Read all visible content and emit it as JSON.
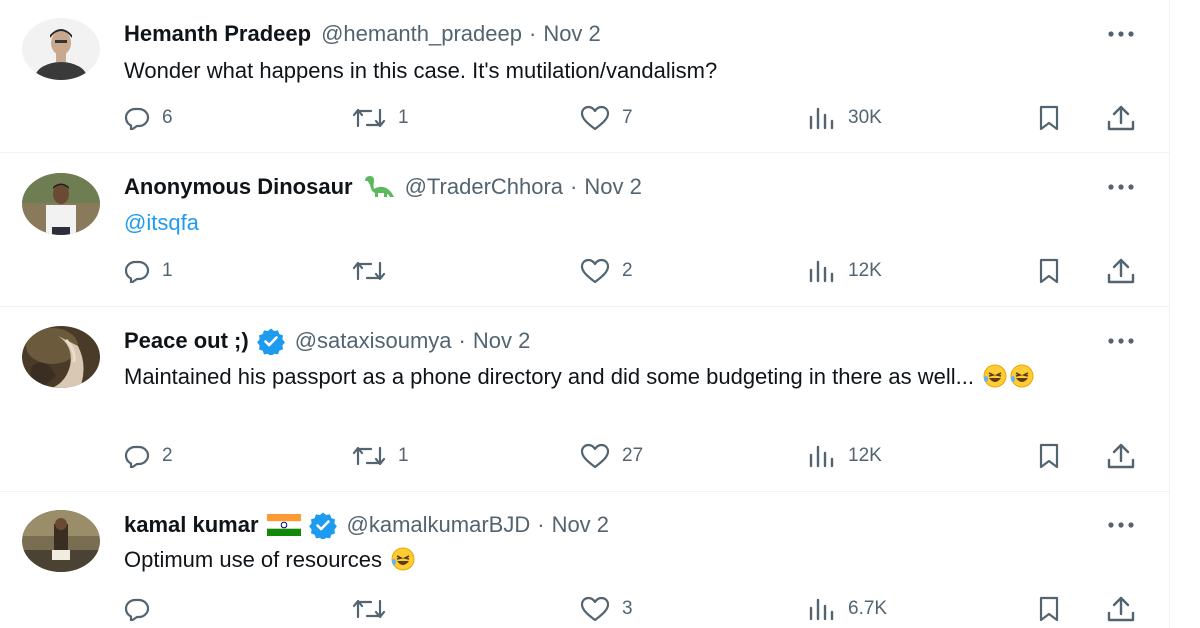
{
  "tweets": [
    {
      "name": "Hemanth Pradeep",
      "handle": "@hemanth_pradeep",
      "separator": "·",
      "date": "Nov 2",
      "text": "Wonder what happens in this case. It's mutilation/vandalism?",
      "stats": {
        "replies": "6",
        "retweets": "1",
        "likes": "7",
        "views": "30K"
      },
      "badge_icon": "none"
    },
    {
      "name": "Anonymous Dinosaur",
      "name_emoji": "sauropod-emoji",
      "handle": "@TraderChhora",
      "separator": "·",
      "date": "Nov 2",
      "text": "@itsqfa",
      "text_is_mention": true,
      "stats": {
        "replies": "1",
        "retweets": "",
        "likes": "2",
        "views": "12K"
      }
    },
    {
      "name": "Peace out ;)",
      "badge_icon": "verified-badge-icon",
      "handle": "@sataxisoumya",
      "separator": "·",
      "date": "Nov 2",
      "text": "Maintained his passport as a phone directory and did some budgeting in there as well...",
      "text_emojis": [
        "rolling-on-floor-laughing-emoji",
        "rolling-on-floor-laughing-emoji"
      ],
      "stats": {
        "replies": "2",
        "retweets": "1",
        "likes": "27",
        "views": "12K"
      }
    },
    {
      "name": "kamal kumar",
      "name_emoji": "india-flag-emoji",
      "badge_icon": "verified-badge-icon",
      "handle": "@kamalkumarBJD",
      "separator": "·",
      "date": "Nov 2",
      "text": "Optimum use of resources",
      "text_emojis": [
        "rolling-on-floor-laughing-emoji"
      ],
      "stats": {
        "replies": "",
        "retweets": "",
        "likes": "3",
        "views": "6.7K"
      }
    }
  ],
  "colors": {
    "text": "#0f1419",
    "secondary": "#536471",
    "link": "#1d9bf0",
    "verified": "#1d9bf0",
    "divider": "#eff3f4"
  },
  "icons": [
    "reply-icon",
    "retweet-icon",
    "like-icon",
    "views-icon",
    "bookmark-icon",
    "share-icon",
    "more-icon"
  ]
}
